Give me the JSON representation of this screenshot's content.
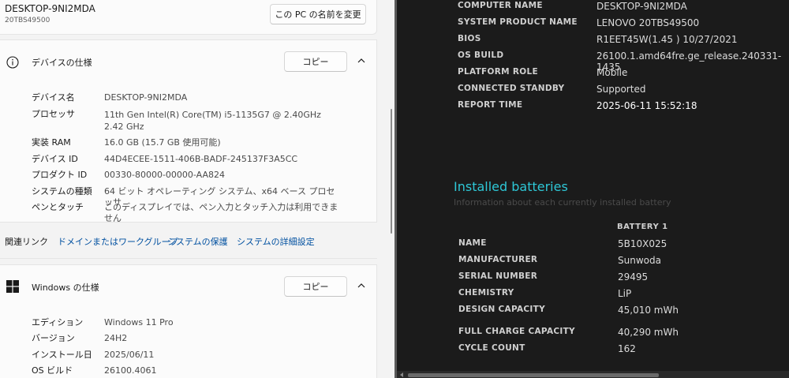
{
  "settings": {
    "pc_name": "DESKTOP-9NI2MDA",
    "pc_model": "20TBS49500",
    "rename_button": "この PC の名前を変更",
    "device_card": {
      "title": "デバイスの仕様",
      "copy_button": "コピー",
      "rows": [
        {
          "key": "デバイス名",
          "value": "DESKTOP-9NI2MDA"
        },
        {
          "key": "プロセッサ",
          "value": "11th Gen Intel(R) Core(TM) i5-1135G7 @ 2.40GHz   2.42 GHz"
        },
        {
          "key": "実装 RAM",
          "value": "16.0 GB (15.7 GB 使用可能)"
        },
        {
          "key": "デバイス ID",
          "value": "44D4ECEE-1511-406B-BADF-245137F3A5CC"
        },
        {
          "key": "プロダクト ID",
          "value": "00330-80000-00000-AA824"
        },
        {
          "key": "システムの種類",
          "value": "64 ビット オペレーティング システム、x64 ベース プロセッサ"
        },
        {
          "key": "ペンとタッチ",
          "value": "このディスプレイでは、ペン入力とタッチ入力は利用できません"
        }
      ]
    },
    "related_links": {
      "label": "関連リンク",
      "links": [
        "ドメインまたはワークグループ",
        "システムの保護",
        "システムの詳細設定"
      ]
    },
    "windows_card": {
      "title": "Windows の仕様",
      "copy_button": "コピー",
      "rows": [
        {
          "key": "エディション",
          "value": "Windows 11 Pro"
        },
        {
          "key": "バージョン",
          "value": "24H2"
        },
        {
          "key": "インストール日",
          "value": "2025/06/11"
        },
        {
          "key": "OS ビルド",
          "value": "26100.4061"
        }
      ]
    }
  },
  "report": {
    "system_rows": [
      {
        "key": "COMPUTER NAME",
        "value": "DESKTOP-9NI2MDA"
      },
      {
        "key": "SYSTEM PRODUCT NAME",
        "value": "LENOVO 20TBS49500"
      },
      {
        "key": "BIOS",
        "value": "R1EET45W(1.45 ) 10/27/2021"
      },
      {
        "key": "OS BUILD",
        "value": "26100.1.amd64fre.ge_release.240331-1435"
      },
      {
        "key": "PLATFORM ROLE",
        "value": "Mobile"
      },
      {
        "key": "CONNECTED STANDBY",
        "value": "Supported"
      },
      {
        "key": "REPORT TIME",
        "value": "2025-06-11   15:52:18"
      }
    ],
    "batteries_title": "Installed batteries",
    "batteries_subtitle": "Information about each currently installed battery",
    "battery_header": "BATTERY 1",
    "battery_rows": [
      {
        "key": "NAME",
        "value": "5B10X025"
      },
      {
        "key": "MANUFACTURER",
        "value": "Sunwoda"
      },
      {
        "key": "SERIAL NUMBER",
        "value": "29495"
      },
      {
        "key": "CHEMISTRY",
        "value": "LiP"
      },
      {
        "key": "DESIGN CAPACITY",
        "value": "45,010 mWh"
      },
      {
        "key": "FULL CHARGE CAPACITY",
        "value": "40,290 mWh"
      },
      {
        "key": "CYCLE COUNT",
        "value": "162"
      }
    ]
  },
  "colors": {
    "accent_link": "#0050a0",
    "report_heading": "#2ec7d6",
    "report_background": "#1b1b1b"
  }
}
